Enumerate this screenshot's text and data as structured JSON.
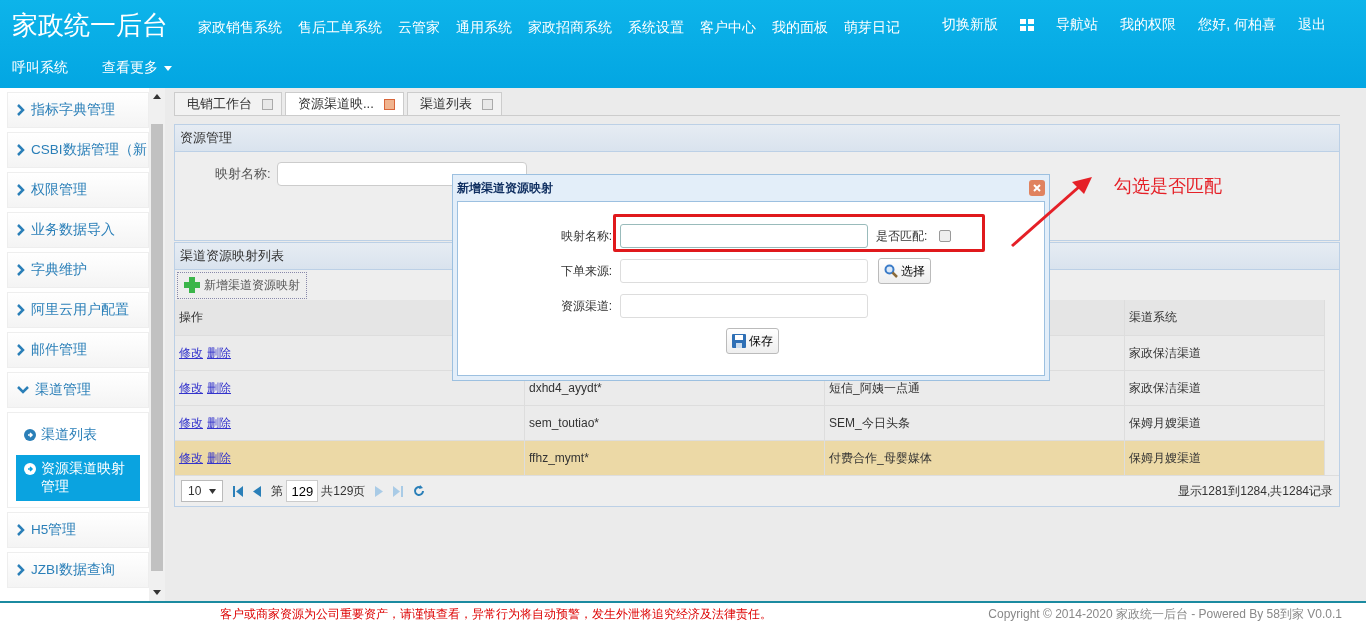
{
  "header": {
    "title": "家政统一后台",
    "nav": [
      "家政销售系统",
      "售后工单系统",
      "云管家",
      "通用系统",
      "家政招商系统",
      "系统设置",
      "客户中心",
      "我的面板",
      "萌芽日记"
    ],
    "right_links": [
      {
        "kind": "text",
        "label": "切换新版"
      },
      {
        "kind": "grid"
      },
      {
        "kind": "text",
        "label": "导航站"
      },
      {
        "kind": "text",
        "label": "我的权限"
      },
      {
        "kind": "text",
        "label": "您好, 何柏喜"
      },
      {
        "kind": "text",
        "label": "退出"
      }
    ],
    "second_row": [
      {
        "label": "呼叫系统",
        "dropdown": false
      },
      {
        "label": "查看更多",
        "dropdown": true
      }
    ]
  },
  "sidebar": {
    "items": [
      {
        "label": "指标字典管理",
        "expanded": false
      },
      {
        "label": "CSBI数据管理（新",
        "expanded": false
      },
      {
        "label": "权限管理",
        "expanded": false
      },
      {
        "label": "业务数据导入",
        "expanded": false
      },
      {
        "label": "字典维护",
        "expanded": false
      },
      {
        "label": "阿里云用户配置",
        "expanded": false
      },
      {
        "label": "邮件管理",
        "expanded": false
      },
      {
        "label": "渠道管理",
        "expanded": true,
        "children": [
          {
            "label": "渠道列表",
            "selected": false
          },
          {
            "label": "资源渠道映射管理",
            "selected": true
          }
        ]
      },
      {
        "label": "H5管理",
        "expanded": false
      },
      {
        "label": "JZBI数据查询",
        "expanded": false
      }
    ]
  },
  "tabs": [
    {
      "label": "电销工作台",
      "selected": false
    },
    {
      "label": "资源渠道映...",
      "selected": true
    },
    {
      "label": "渠道列表",
      "selected": false
    }
  ],
  "search_panel": {
    "title": "资源管理",
    "fields": [
      {
        "label": "映射名称:"
      }
    ]
  },
  "list_panel": {
    "title": "渠道资源映射列表",
    "add_button": "新增渠道资源映射",
    "table": {
      "header": {
        "column_1": "操作",
        "column_4": "渠道系统"
      },
      "rows": [
        {
          "actions": [
            "修改",
            "删除"
          ],
          "column_4": "家政保洁渠道",
          "selected": false
        },
        {
          "actions": [
            "修改",
            "删除"
          ],
          "column_2": "dxhd4_ayydt*",
          "column_3": "短信_阿姨一点通",
          "column_4": "家政保洁渠道",
          "selected": false
        },
        {
          "actions": [
            "修改",
            "删除"
          ],
          "column_2": "sem_toutiao*",
          "column_3": "SEM_今日头条",
          "column_4": "保姆月嫂渠道",
          "selected": false
        },
        {
          "actions": [
            "修改",
            "删除"
          ],
          "column_2": "ffhz_mymt*",
          "column_3": "付费合作_母婴媒体",
          "column_4": "保姆月嫂渠道",
          "selected": true
        }
      ]
    },
    "pager": {
      "page_size": "10",
      "page_prefix": "第",
      "page": "129",
      "page_total": "共129页",
      "info": "显示1281到1284,共1284记录"
    }
  },
  "dialog": {
    "title": "新增渠道资源映射",
    "fields": [
      {
        "kind": "text",
        "label": "映射名称:",
        "check_label": "是否匹配:",
        "checked": false
      },
      {
        "kind": "picker",
        "label": "下单来源:",
        "button": "选择"
      },
      {
        "kind": "plain",
        "label": "资源渠道:"
      }
    ],
    "save_button": "保存"
  },
  "annotation": {
    "text": "勾选是否匹配"
  },
  "footer": {
    "notice": "客户或商家资源为公司重要资产，请谨慎查看，异常行为将自动预警，发生外泄将追究经济及法律责任。",
    "copyright": "Copyright © 2014-2020 家政统一后台 - Powered By 58到家 V0.0.1"
  }
}
